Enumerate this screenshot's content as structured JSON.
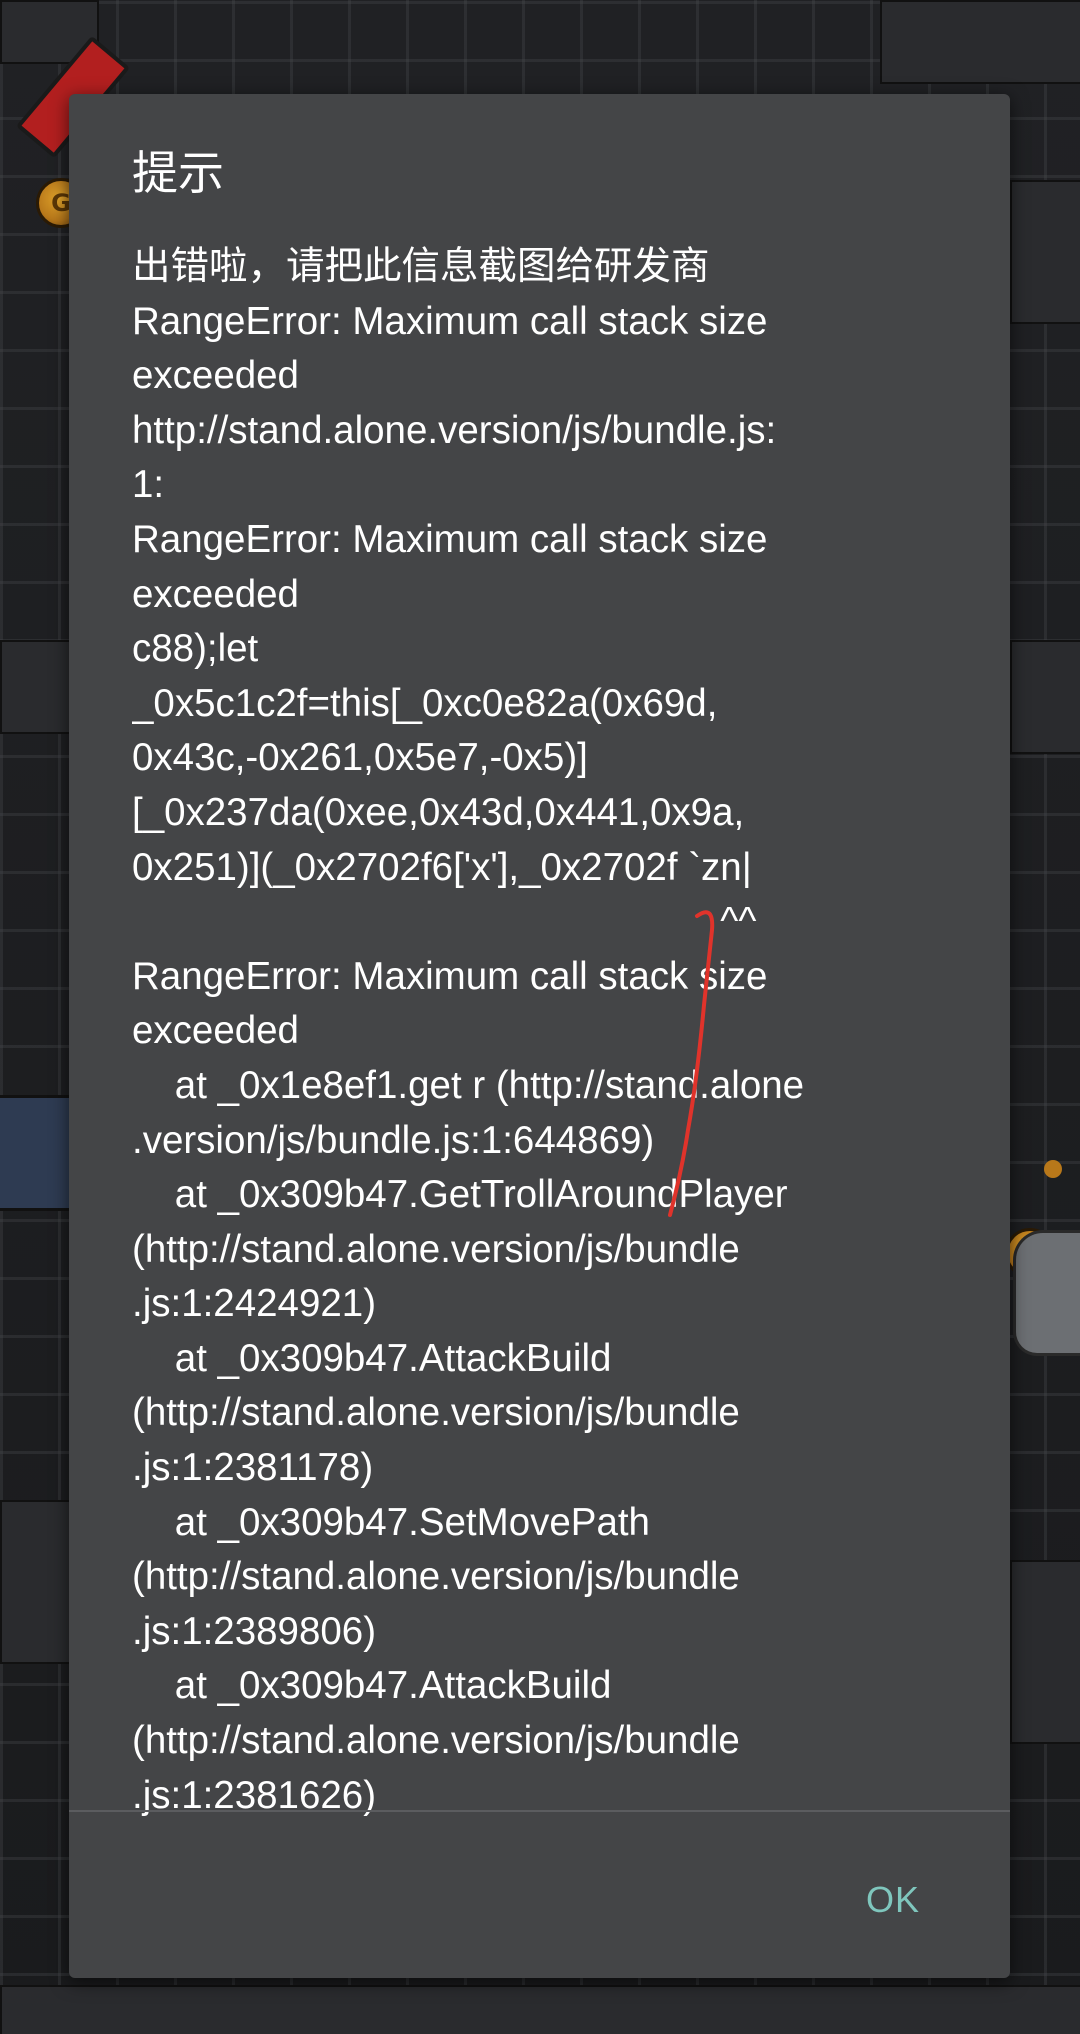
{
  "dialog": {
    "title": "提示",
    "message_lines": [
      "出错啦，请把此信息截图给研发商",
      "RangeError: Maximum call stack size",
      "exceeded",
      "http://stand.alone.version/js/bundle.js:",
      "1:",
      "RangeError: Maximum call stack size",
      "exceeded",
      "c88);let",
      "_0x5c1c2f=this[_0xc0e82a(0x69d,",
      "0x43c,-0x261,0x5e7,-0x5)]",
      "[_0x237da(0xee,0x43d,0x441,0x9a,",
      "0x251)](_0x2702f6['x'],_0x2702f `zn|",
      "                                                       ^^",
      "RangeError: Maximum call stack size",
      "exceeded",
      "    at _0x1e8ef1.get r (http://stand.alone",
      ".version/js/bundle.js:1:644869)",
      "    at _0x309b47.GetTrollAroundPlayer",
      "(http://stand.alone.version/js/bundle",
      ".js:1:2424921)",
      "    at _0x309b47.AttackBuild",
      "(http://stand.alone.version/js/bundle",
      ".js:1:2381178)",
      "    at _0x309b47.SetMovePath",
      "(http://stand.alone.version/js/bundle",
      ".js:1:2389806)",
      "    at _0x309b47.AttackBuild",
      "(http://stand.alone.version/js/bundle",
      ".js:1:2381626)"
    ],
    "ok_label": "OK",
    "ok_color": "#7fc6bd",
    "annotation_color": "#e0332b"
  },
  "background": {
    "coin_label": "G"
  }
}
